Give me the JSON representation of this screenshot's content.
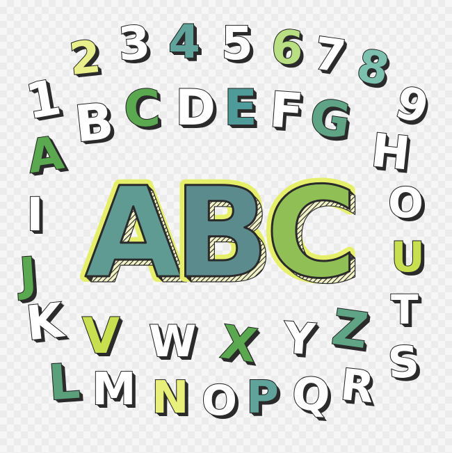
{
  "hero": {
    "letters": [
      {
        "ch": "A",
        "color": "#5f9b93"
      },
      {
        "ch": "B",
        "color": "#5b8b8d"
      },
      {
        "ch": "C",
        "color": "#8fbf55"
      }
    ],
    "outline_glow": "#e6ef6a",
    "shadow": "#2a2a2a"
  },
  "glyphs": [
    {
      "ch": "1",
      "color": "#ffffff",
      "shadow": "#2b2b2b"
    },
    {
      "ch": "2",
      "color": "#e9f08b",
      "shadow": "#2b2b2b"
    },
    {
      "ch": "3",
      "color": "#ffffff",
      "shadow": "#2b2b2b"
    },
    {
      "ch": "4",
      "color": "#5fa39b",
      "shadow": "#2b2b2b"
    },
    {
      "ch": "5",
      "color": "#ffffff",
      "shadow": "#2b2b2b"
    },
    {
      "ch": "6",
      "color": "#b8df82",
      "shadow": "#2b2b2b"
    },
    {
      "ch": "7",
      "color": "#ffffff",
      "shadow": "#2b2b2b"
    },
    {
      "ch": "8",
      "color": "#7cc0b0",
      "shadow": "#2b2b2b"
    },
    {
      "ch": "9",
      "color": "#ffffff",
      "shadow": "#2b2b2b"
    },
    {
      "ch": "A",
      "color": "#5aa84f",
      "shadow": "#2b2b2b"
    },
    {
      "ch": "B",
      "color": "#ffffff",
      "shadow": "#2b2b2b"
    },
    {
      "ch": "C",
      "color": "#5aa84f",
      "shadow": "#2b2b2b"
    },
    {
      "ch": "D",
      "color": "#ffffff",
      "shadow": "#2b2b2b"
    },
    {
      "ch": "E",
      "color": "#4e9b9a",
      "shadow": "#2b2b2b"
    },
    {
      "ch": "F",
      "color": "#ffffff",
      "shadow": "#2b2b2b"
    },
    {
      "ch": "G",
      "color": "#5fa585",
      "shadow": "#2b2b2b"
    },
    {
      "ch": "H",
      "color": "#ffffff",
      "shadow": "#2b2b2b"
    },
    {
      "ch": "I",
      "color": "#ffffff",
      "shadow": "#2b2b2b"
    },
    {
      "ch": "J",
      "color": "#5aa84f",
      "shadow": "#2b2b2b"
    },
    {
      "ch": "O",
      "color": "#ffffff",
      "shadow": "#2b2b2b"
    },
    {
      "ch": "K",
      "color": "#ffffff",
      "shadow": "#2b2b2b"
    },
    {
      "ch": "V",
      "color": "#c8df4f",
      "shadow": "#2b2b2b"
    },
    {
      "ch": "W",
      "color": "#ffffff",
      "shadow": "#2b2b2b"
    },
    {
      "ch": "X",
      "color": "#5aa84f",
      "shadow": "#2b2b2b"
    },
    {
      "ch": "Y",
      "color": "#ffffff",
      "shadow": "#2b2b2b"
    },
    {
      "ch": "Z",
      "color": "#5fa585",
      "shadow": "#2b2b2b"
    },
    {
      "ch": "U",
      "color": "#c8df4f",
      "shadow": "#2b2b2b"
    },
    {
      "ch": "T",
      "color": "#ffffff",
      "shadow": "#2b2b2b"
    },
    {
      "ch": "S",
      "color": "#ffffff",
      "shadow": "#2b2b2b"
    },
    {
      "ch": "L",
      "color": "#5aa07a",
      "shadow": "#2b2b2b"
    },
    {
      "ch": "M",
      "color": "#ffffff",
      "shadow": "#2b2b2b"
    },
    {
      "ch": "N",
      "color": "#e8ef7a",
      "shadow": "#2b2b2b"
    },
    {
      "ch": "O",
      "color": "#ffffff",
      "shadow": "#2b2b2b"
    },
    {
      "ch": "P",
      "color": "#5fa39b",
      "shadow": "#2b2b2b"
    },
    {
      "ch": "Q",
      "color": "#ffffff",
      "shadow": "#2b2b2b"
    },
    {
      "ch": "R",
      "color": "#ffffff",
      "shadow": "#2b2b2b"
    }
  ]
}
